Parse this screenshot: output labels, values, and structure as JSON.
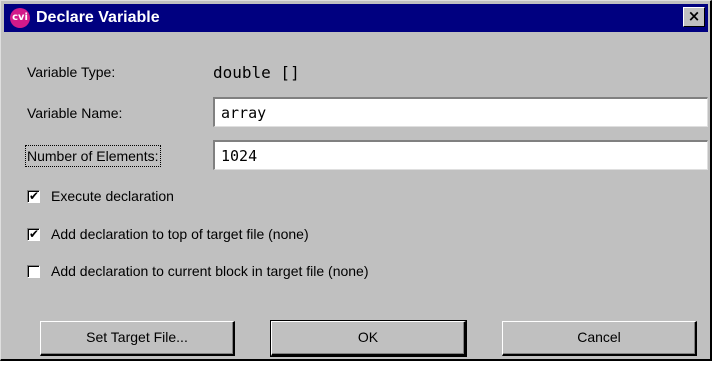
{
  "window": {
    "title": "Declare Variable",
    "icon_text": "cvi",
    "icon_color": "#d21a8a",
    "close_symbol": "×"
  },
  "fields": {
    "variable_type_label": "Variable Type:",
    "variable_type_value": "double []",
    "variable_name_label": "Variable Name:",
    "variable_name_value": "array",
    "num_elements_label": "Number of Elements:",
    "num_elements_value": "1024"
  },
  "checkboxes": [
    {
      "label": "Execute declaration",
      "checked": true
    },
    {
      "label": "Add declaration to top of target file (none)",
      "checked": true
    },
    {
      "label": "Add declaration to current block in target file (none)",
      "checked": false
    }
  ],
  "buttons": {
    "set_target": "Set Target File...",
    "ok": "OK",
    "cancel": "Cancel"
  },
  "colors": {
    "titlebar": "#000080",
    "dialog_face": "#c0c0c0"
  }
}
